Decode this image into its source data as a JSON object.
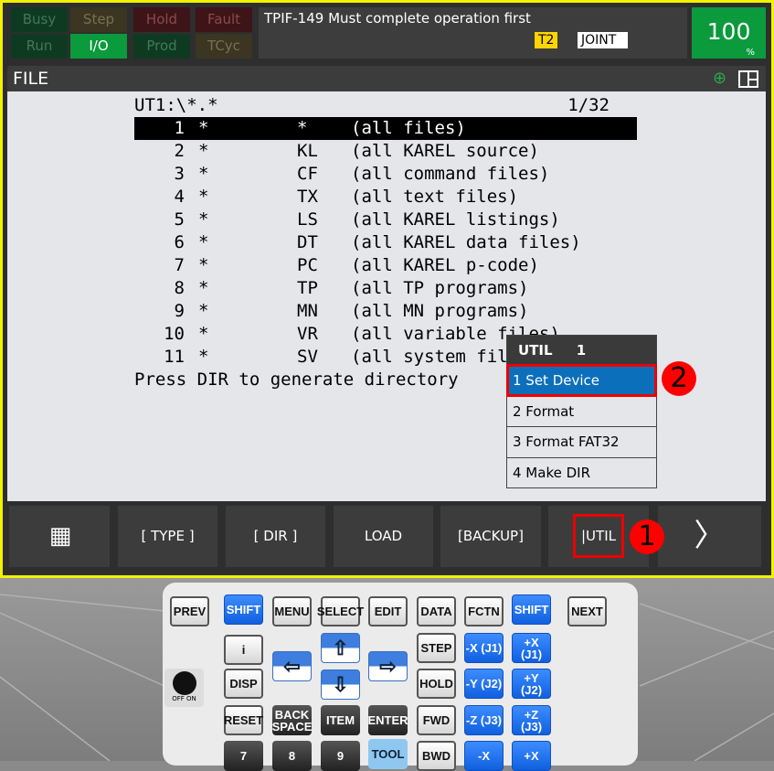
{
  "status": {
    "row1": [
      "Busy",
      "Step",
      "Hold",
      "Fault"
    ],
    "row2": [
      "Run",
      "I/O",
      "Prod",
      "TCyc"
    ]
  },
  "message": "TPIF-149 Must complete operation first",
  "mode": "T2",
  "coord": "JOINT",
  "override": {
    "value": "100",
    "unit": "%"
  },
  "screen_title": "FILE",
  "listing": {
    "path": "UT1:\\*.*",
    "page": "1/32",
    "rows": [
      {
        "n": "1",
        "s": "*",
        "ext": "*",
        "desc": "(all files)"
      },
      {
        "n": "2",
        "s": "*",
        "ext": "KL",
        "desc": "(all KAREL source)"
      },
      {
        "n": "3",
        "s": "*",
        "ext": "CF",
        "desc": "(all command files)"
      },
      {
        "n": "4",
        "s": "*",
        "ext": "TX",
        "desc": "(all text files)"
      },
      {
        "n": "5",
        "s": "*",
        "ext": "LS",
        "desc": "(all KAREL listings)"
      },
      {
        "n": "6",
        "s": "*",
        "ext": "DT",
        "desc": "(all KAREL data files)"
      },
      {
        "n": "7",
        "s": "*",
        "ext": "PC",
        "desc": "(all KAREL p-code)"
      },
      {
        "n": "8",
        "s": "*",
        "ext": "TP",
        "desc": "(all TP programs)"
      },
      {
        "n": "9",
        "s": "*",
        "ext": "MN",
        "desc": "(all MN programs)"
      },
      {
        "n": "10",
        "s": "*",
        "ext": "VR",
        "desc": "(all variable files)"
      },
      {
        "n": "11",
        "s": "*",
        "ext": "SV",
        "desc": "(all system files)"
      }
    ],
    "footer": "Press DIR to generate directory"
  },
  "popup": {
    "title": "UTIL",
    "page": "1",
    "items": [
      "1 Set Device",
      "2 Format",
      "3 Format FAT32",
      "4 Make DIR"
    ]
  },
  "fkeys": [
    "[ TYPE ]",
    "[ DIR ]",
    "LOAD",
    "[BACKUP]",
    "|UTIL"
  ],
  "markers": [
    "1",
    "2"
  ],
  "keypad": {
    "prev": "PREV",
    "shift": "SHIFT",
    "menu": "MENU",
    "select": "SELECT",
    "edit": "EDIT",
    "data": "DATA",
    "fctn": "FCTN",
    "next": "NEXT",
    "info": "i",
    "disp": "DISP",
    "reset": "RESET",
    "backspace": "BACK SPACE",
    "item": "ITEM",
    "enter": "ENTER",
    "step": "STEP",
    "hold": "HOLD",
    "fwd": "FWD",
    "bwd": "BWD",
    "tool": "TOOL",
    "mx": "-X (J1)",
    "px": "+X (J1)",
    "my": "-Y (J2)",
    "py": "+Y (J2)",
    "mz": "-Z (J3)",
    "pz": "+Z (J3)",
    "mrx": "-X",
    "prx": "+X",
    "n7": "7",
    "n8": "8",
    "n9": "9",
    "off": "OFF",
    "on": "ON"
  }
}
